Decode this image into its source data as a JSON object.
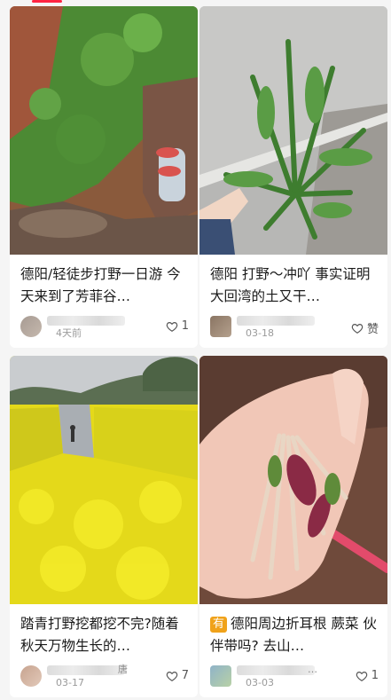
{
  "feed": {
    "cards": [
      {
        "title": "德阳/轻徒步打野一日游 今天来到了芳菲谷…",
        "author_tail": "",
        "date": "4天前",
        "likes": "1"
      },
      {
        "title": "德阳 打野～冲吖 事实证明大回湾的土又干…",
        "author_tail": "",
        "date": "03-18",
        "likes": "赞"
      },
      {
        "title": "踏青打野挖都挖不完?随着秋天万物生长的…",
        "author_tail": "唐",
        "date": "03-17",
        "likes": "7"
      },
      {
        "tag": "有",
        "title": "德阳周边折耳根 蕨菜 伙伴带吗? 去山…",
        "author_tail": "…",
        "date": "03-03",
        "likes": "1"
      }
    ]
  },
  "colors": {
    "accent": "#ff2442",
    "tag": "#f0a21a"
  }
}
